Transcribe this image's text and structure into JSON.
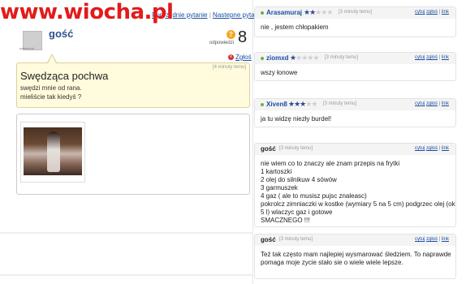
{
  "site": {
    "watermark": "www.wiocha.pl"
  },
  "question_nav": {
    "prev": "Poprzednie pytanie",
    "sep": "|",
    "next": "Nastepne pytanie"
  },
  "asker": {
    "name": "gość",
    "avatar_label": "szkolna.pl"
  },
  "answers_counter": {
    "icon": "?",
    "count": "8",
    "label": "odpowiedzi"
  },
  "report": {
    "icon": "x",
    "label": "Zgłoś"
  },
  "question": {
    "time": "[4 minuty temu]",
    "title": "Swędząca pochwa",
    "body_line1": "swędzi mnie od rana.",
    "body_line2": "mieliście tak kiedyś ?"
  },
  "answers": [
    {
      "user": "Arasamuraj",
      "rating": 2,
      "max": 5,
      "time": "[3 minuty temu]",
      "actions": {
        "quote": "cytuj",
        "report": "zgłoś",
        "sep": "|",
        "link": "link"
      },
      "lines": [
        "nie , jestem chłopakiem"
      ]
    },
    {
      "user": "ziomxd",
      "rating": 1,
      "max": 5,
      "time": "[3 minuty temu]",
      "actions": {
        "quote": "cytuj",
        "report": "zgłoś",
        "sep": "|",
        "link": "link"
      },
      "lines": [
        "wszy łonowe"
      ]
    },
    {
      "user": "Xiven8",
      "rating": 3,
      "max": 5,
      "time": "[3 minuty temu]",
      "actions": {
        "quote": "cytuj",
        "report": "zgłoś",
        "sep": "|",
        "link": "link"
      },
      "lines": [
        "ja tu widzę niezły burdel!"
      ]
    },
    {
      "user": "gość",
      "time": "[3 minuty temu]",
      "actions": {
        "quote": "cytuj",
        "report": "zgłoś",
        "sep": "|",
        "link": "link"
      },
      "lines": [
        "nie wiem co to znaczy ale znam przepis na frytki",
        "1 kartoszki",
        "2 olej do silnikuw 4 sówów",
        "3 garmuszek",
        "4 gaz ( ale to musisz pujsc znaleasc)",
        "pokrolcz zimniaczki w kostke (wymiary 5 na 5 cm) podgrzec olej (ok",
        "5 l) wlaczyc gaz i gotowe",
        "SMACZNEGO !!!"
      ]
    },
    {
      "user": "gość",
      "time": "[3 minuty temu]",
      "actions": {
        "quote": "cytuj",
        "report": "zgłoś",
        "sep": "|",
        "link": "link"
      },
      "lines": [
        "Też tak często mam najlepiej wysmarować śledziem. To naprawde",
        "pomaga moje zycie stało sie o wiele wiele lepsze."
      ]
    }
  ],
  "colors": {
    "accent": "#1a4fa3",
    "watermark": "#e21b1b",
    "question_bg": "#fffbdc",
    "star": "#2b4a8f",
    "bullet": "#6ab04c"
  }
}
